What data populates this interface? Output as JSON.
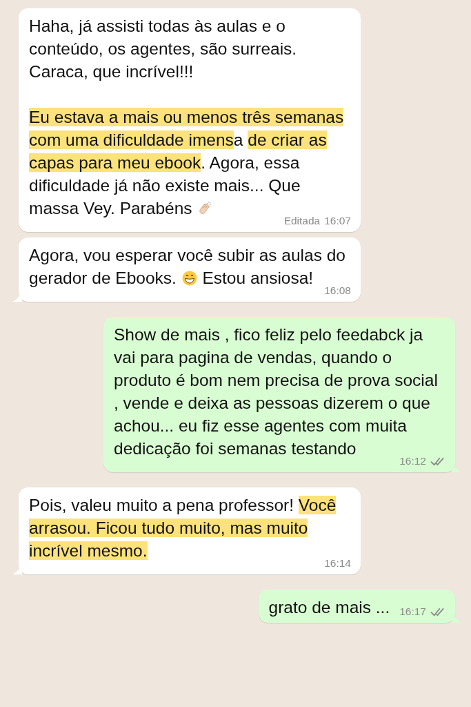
{
  "messages": [
    {
      "kind": "incoming",
      "tail": false,
      "paragraphs": [
        [
          {
            "kind": "text",
            "text": "Haha, já assisti todas às aulas e o conteúdo, os agentes, são surreais. Caraca, que incrível!!!"
          }
        ],
        [
          {
            "kind": "highlight",
            "text": "Eu estava a mais ou menos três semanas com uma dificuldade imens"
          },
          {
            "kind": "text",
            "text": "a "
          },
          {
            "kind": "highlight",
            "text": "de criar as capas para meu ebook"
          },
          {
            "kind": "text",
            "text": ". Agora, essa dificuldade já não existe mais... Que massa Vey. Parabéns "
          },
          {
            "kind": "clap"
          }
        ]
      ],
      "edited_label": "Editada",
      "time": "16:07"
    },
    {
      "kind": "incoming",
      "tail": true,
      "paragraphs": [
        [
          {
            "kind": "text",
            "text": "Agora, vou esperar você subir as aulas do gerador de Ebooks. "
          },
          {
            "kind": "grin"
          },
          {
            "kind": "text",
            "text": " Estou ansiosa!"
          }
        ]
      ],
      "time": "16:08"
    },
    {
      "kind": "outgoing",
      "tail": true,
      "paragraphs": [
        [
          {
            "kind": "text",
            "text": "Show de mais , fico feliz pelo feedabck ja vai para pagina de vendas, quando o produto é bom nem precisa de prova social , vende e deixa as pessoas dizerem o que achou... eu fiz esse agentes com muita dedicação foi semanas testando"
          }
        ]
      ],
      "time": "16:12",
      "read": false
    },
    {
      "kind": "incoming",
      "tail": true,
      "paragraphs": [
        [
          {
            "kind": "text",
            "text": "Pois, valeu muito a pena professor! "
          },
          {
            "kind": "highlight",
            "text": "Você arrasou. Ficou tudo muito, mas muito incrível mesmo."
          }
        ]
      ],
      "time": "16:14"
    },
    {
      "kind": "outgoing",
      "tail": true,
      "paragraphs": [
        [
          {
            "kind": "text",
            "text": "grato de mais ..."
          }
        ]
      ],
      "time": "16:17",
      "read": false
    }
  ]
}
